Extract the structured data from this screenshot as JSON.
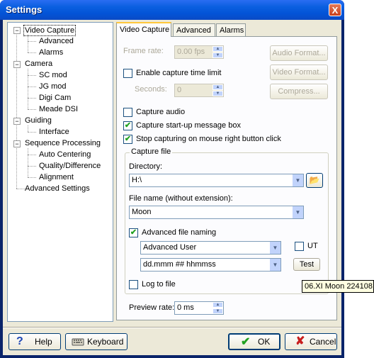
{
  "window": {
    "title": "Settings",
    "close_glyph": "X"
  },
  "tree": {
    "items": [
      {
        "label": "Video Capture",
        "level": 0
      },
      {
        "label": "Advanced",
        "level": 1
      },
      {
        "label": "Alarms",
        "level": 1
      },
      {
        "label": "Camera",
        "level": 0
      },
      {
        "label": "SC mod",
        "level": 1
      },
      {
        "label": "JG mod",
        "level": 1
      },
      {
        "label": "Digi Cam",
        "level": 1
      },
      {
        "label": "Meade DSI",
        "level": 1
      },
      {
        "label": "Guiding",
        "level": 0
      },
      {
        "label": "Interface",
        "level": 1
      },
      {
        "label": "Sequence Processing",
        "level": 0
      },
      {
        "label": "Auto Centering",
        "level": 1
      },
      {
        "label": "Quality/Difference",
        "level": 1
      },
      {
        "label": "Alignment",
        "level": 1
      },
      {
        "label": "Advanced Settings",
        "level": 0
      }
    ],
    "expander_glyph": "−"
  },
  "tabs": [
    {
      "label": "Video Capture",
      "active": true
    },
    {
      "label": "Advanced",
      "active": false
    },
    {
      "label": "Alarms",
      "active": false
    }
  ],
  "video": {
    "frame_rate_label": "Frame rate:",
    "frame_rate_value": "0.00 fps",
    "audio_format_button": "Audio Format...",
    "enable_time_limit_label": "Enable capture time limit",
    "enable_time_limit_checked": false,
    "video_format_button": "Video Format...",
    "seconds_label": "Seconds:",
    "seconds_value": "0",
    "compress_button": "Compress...",
    "capture_audio_label": "Capture audio",
    "capture_audio_checked": false,
    "startup_message_label": "Capture start-up  message box",
    "startup_message_checked": true,
    "stop_right_button_label": "Stop capturing on mouse right button click",
    "stop_right_button_checked": true
  },
  "capture_file": {
    "group_label": "Capture file",
    "directory_label": "Directory:",
    "directory_value": "H:\\",
    "filename_label": "File name (without extension):",
    "filename_value": "Moon",
    "advanced_naming_label": "Advanced file naming",
    "advanced_naming_checked": true,
    "naming_mode_value": "Advanced User",
    "ut_label": "UT",
    "ut_checked": false,
    "format_value": "dd.mmm ## hhmmss",
    "test_button": "Test",
    "log_to_file_label": "Log to file",
    "log_to_file_checked": false
  },
  "tooltip_text": "06.XI Moon 224108",
  "preview": {
    "label": "Preview rate:",
    "value": "0 ms"
  },
  "buttons": {
    "help": "Help",
    "keyboard": "Keyboard",
    "ok": "OK",
    "cancel": "Cancel"
  },
  "glyphs": {
    "check": "✔",
    "dropdown": "▼",
    "spin_up": "▲",
    "spin_down": "▼",
    "help_icon": "?",
    "ok_icon": "✔",
    "cancel_icon": "✘",
    "folder_icon": "📂"
  },
  "colors": {
    "title_bar": "#0a5fe0",
    "ok_green": "#21a121",
    "cancel_red": "#c81e1e",
    "help_blue": "#1e46b4"
  }
}
